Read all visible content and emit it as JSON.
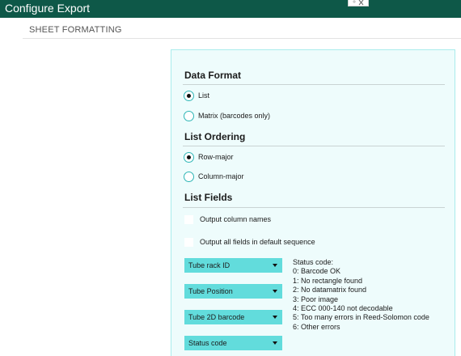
{
  "window": {
    "title": "Configure Export"
  },
  "section": {
    "header": "SHEET FORMATTING"
  },
  "data_format": {
    "title": "Data Format",
    "options": [
      {
        "label": "List",
        "checked": true
      },
      {
        "label": "Matrix (barcodes only)",
        "checked": false
      }
    ]
  },
  "list_ordering": {
    "title": "List Ordering",
    "options": [
      {
        "label": "Row-major",
        "checked": true
      },
      {
        "label": "Column-major",
        "checked": false
      }
    ]
  },
  "list_fields": {
    "title": "List Fields",
    "checkboxes": [
      {
        "label": "Output column names",
        "checked": false
      },
      {
        "label": "Output all fields in default sequence",
        "checked": false
      }
    ],
    "dropdowns": [
      {
        "selected": "Tube rack ID"
      },
      {
        "selected": "Tube Position"
      },
      {
        "selected": "Tube 2D barcode"
      },
      {
        "selected": "Status code"
      }
    ],
    "status_codes": {
      "heading": "Status code:",
      "lines": [
        "0: Barcode OK",
        "1: No rectangle found",
        "2: No datamatrix found",
        "3: Poor image",
        "4: ECC 000-140 not decodable",
        "5: Too many errors in Reed-Solomon code",
        "6: Other errors"
      ]
    }
  },
  "colors": {
    "titlebar": "#0e5848",
    "panel_bg": "#eefcfc",
    "accent": "#62dcdc",
    "radio_border": "#2fb6b6"
  }
}
